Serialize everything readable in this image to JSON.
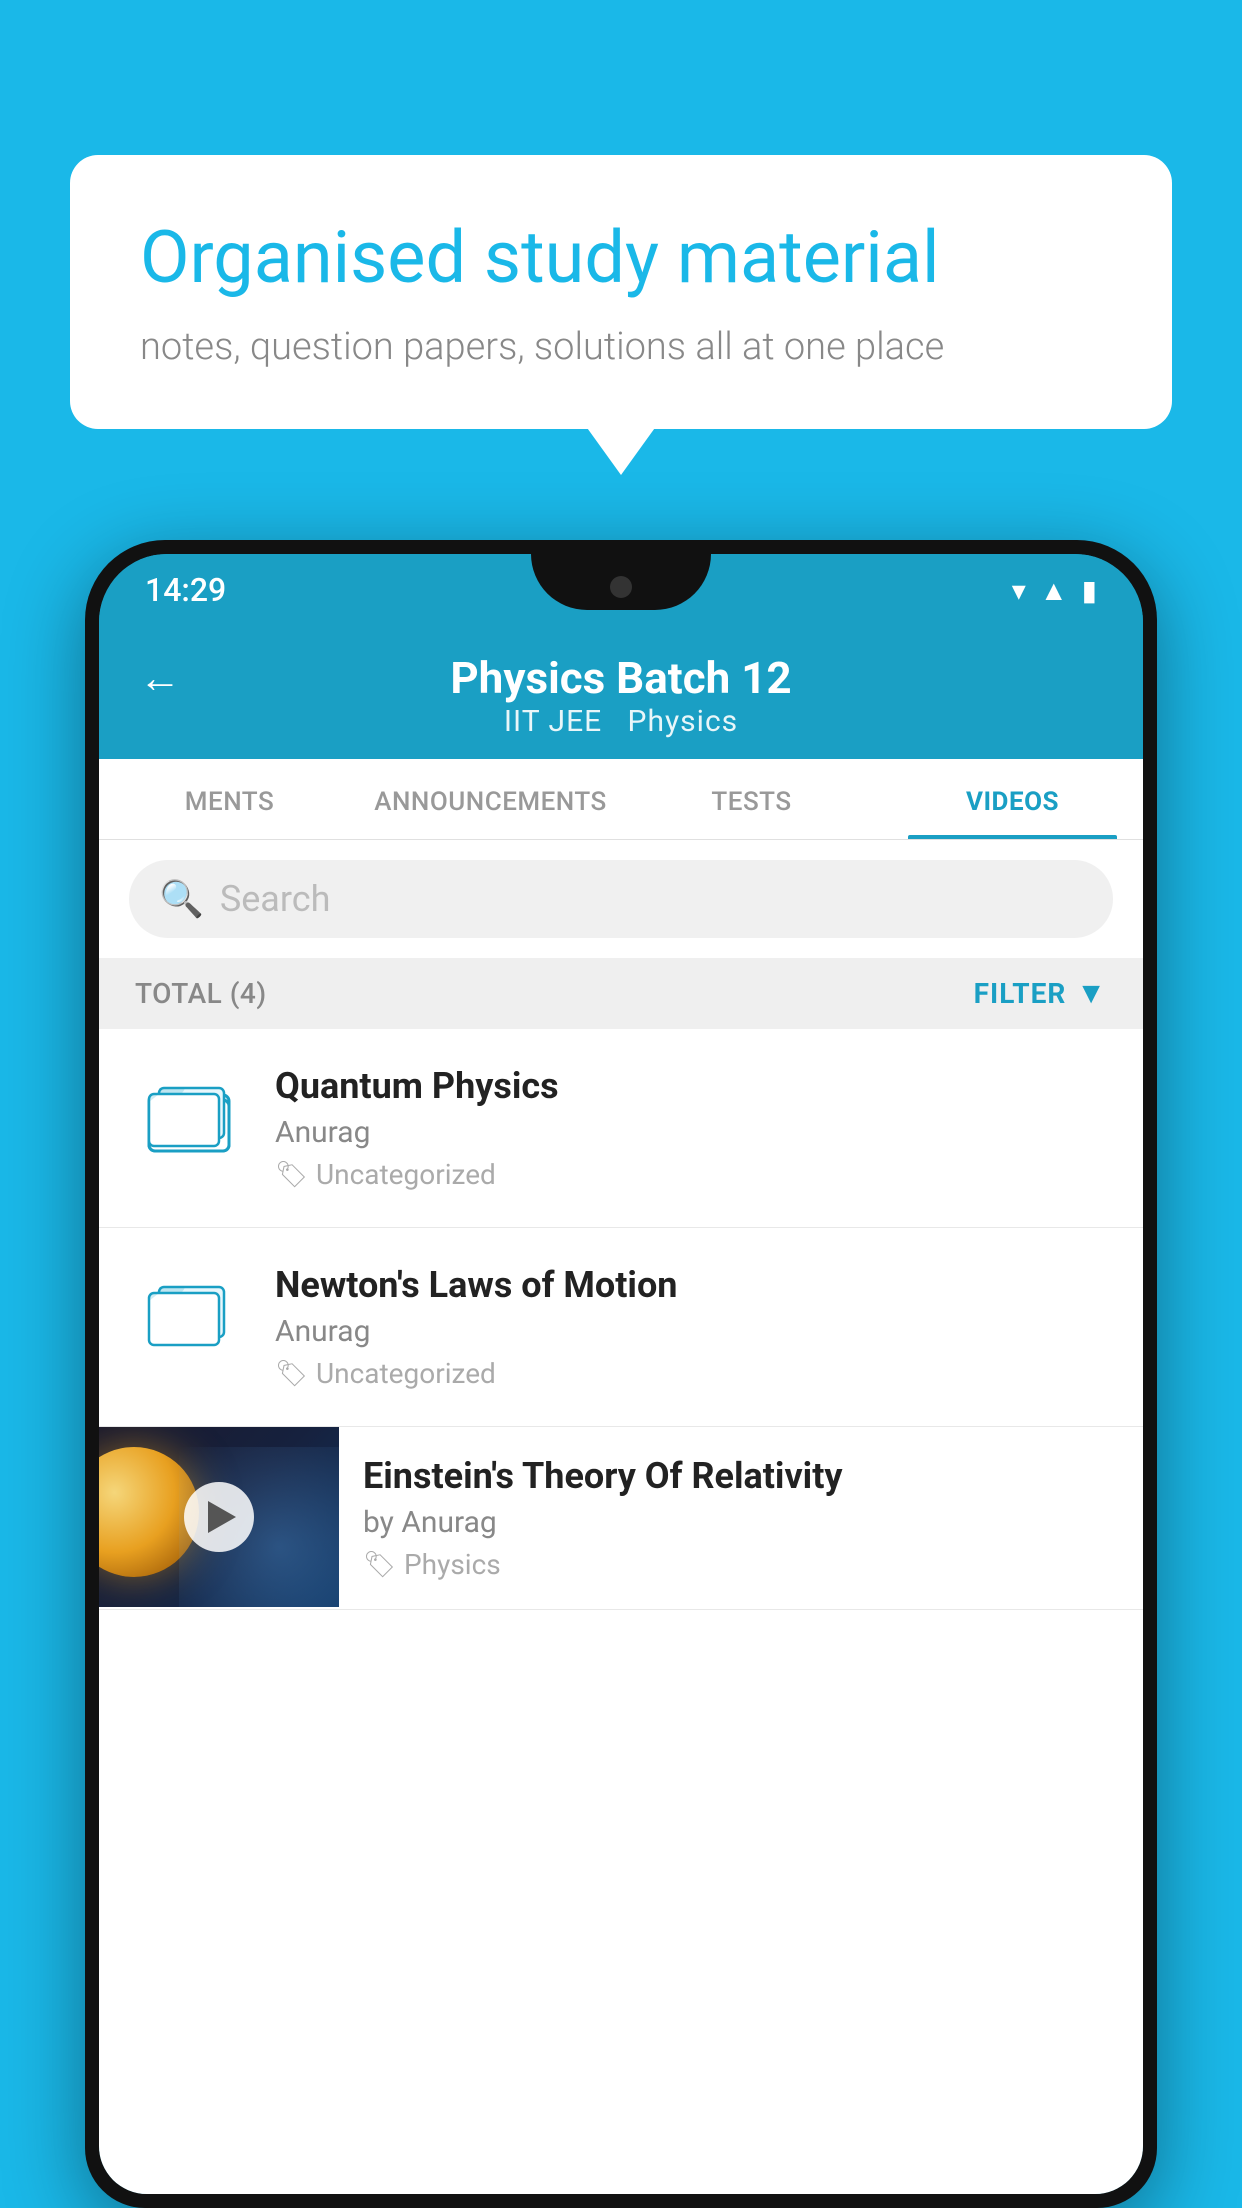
{
  "background_color": "#1ab8e8",
  "speech_bubble": {
    "title": "Organised study material",
    "subtitle": "notes, question papers, solutions all at one place"
  },
  "phone": {
    "status_bar": {
      "time": "14:29"
    },
    "app_bar": {
      "back_label": "←",
      "title": "Physics Batch 12",
      "subtitle_part1": "IIT JEE",
      "subtitle_part2": "Physics"
    },
    "tabs": [
      {
        "label": "MENTS",
        "active": false
      },
      {
        "label": "ANNOUNCEMENTS",
        "active": false
      },
      {
        "label": "TESTS",
        "active": false
      },
      {
        "label": "VIDEOS",
        "active": true
      }
    ],
    "search": {
      "placeholder": "Search"
    },
    "filter_bar": {
      "total_label": "TOTAL (4)",
      "filter_label": "FILTER"
    },
    "video_items": [
      {
        "title": "Quantum Physics",
        "author": "Anurag",
        "tag": "Uncategorized",
        "type": "folder"
      },
      {
        "title": "Newton's Laws of Motion",
        "author": "Anurag",
        "tag": "Uncategorized",
        "type": "folder"
      },
      {
        "title": "Einstein's Theory Of Relativity",
        "author": "by Anurag",
        "tag": "Physics",
        "type": "video"
      }
    ]
  }
}
